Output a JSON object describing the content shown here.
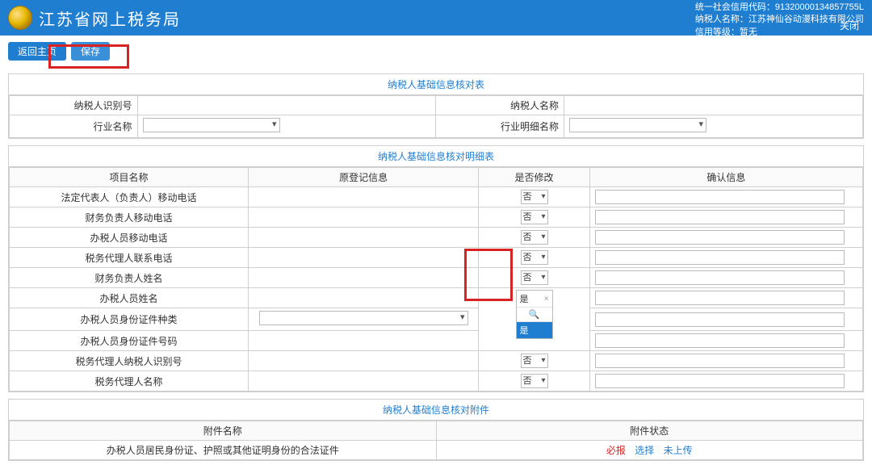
{
  "header": {
    "site_title": "江苏省网上税务局",
    "credit_label": "统一社会信用代码：",
    "credit_code": "91320000134857755L",
    "name_label": "纳税人名称：",
    "name_value": "江苏神仙谷动漫科技有限公司",
    "level_label": "信用等级：",
    "level_value": "暂无",
    "close": "关闭"
  },
  "toolbar": {
    "back_label": "返回主页",
    "save_label": "保存"
  },
  "section1": {
    "title": "纳税人基础信息核对表",
    "r1_col1_label": "纳税人识别号",
    "r1_col2_label": "纳税人名称",
    "r2_col1_label": "行业名称",
    "r2_col2_label": "行业明细名称"
  },
  "section2": {
    "title": "纳税人基础信息核对明细表",
    "header": {
      "c1": "项目名称",
      "c2": "原登记信息",
      "c3": "是否修改",
      "c4": "确认信息"
    },
    "rows": [
      {
        "name": "法定代表人（负责人）移动电话"
      },
      {
        "name": "财务负责人移动电话"
      },
      {
        "name": "办税人员移动电话"
      },
      {
        "name": "税务代理人联系电话"
      },
      {
        "name": "财务负责人姓名"
      },
      {
        "name": "办税人员姓名"
      },
      {
        "name": "办税人员身份证件种类"
      },
      {
        "name": "办税人员身份证件号码"
      },
      {
        "name": "税务代理人纳税人识别号"
      },
      {
        "name": "税务代理人名称"
      }
    ],
    "dd_default": "否",
    "dd_open_head": "是",
    "dd_open_opt": "是"
  },
  "section3": {
    "title": "纳税人基础信息核对附件",
    "header": {
      "c1": "附件名称",
      "c2": "附件状态"
    },
    "row": {
      "name": "办税人员居民身份证、护照或其他证明身份的合法证件",
      "req": "必报",
      "link": "选择",
      "status": "未上传"
    }
  }
}
